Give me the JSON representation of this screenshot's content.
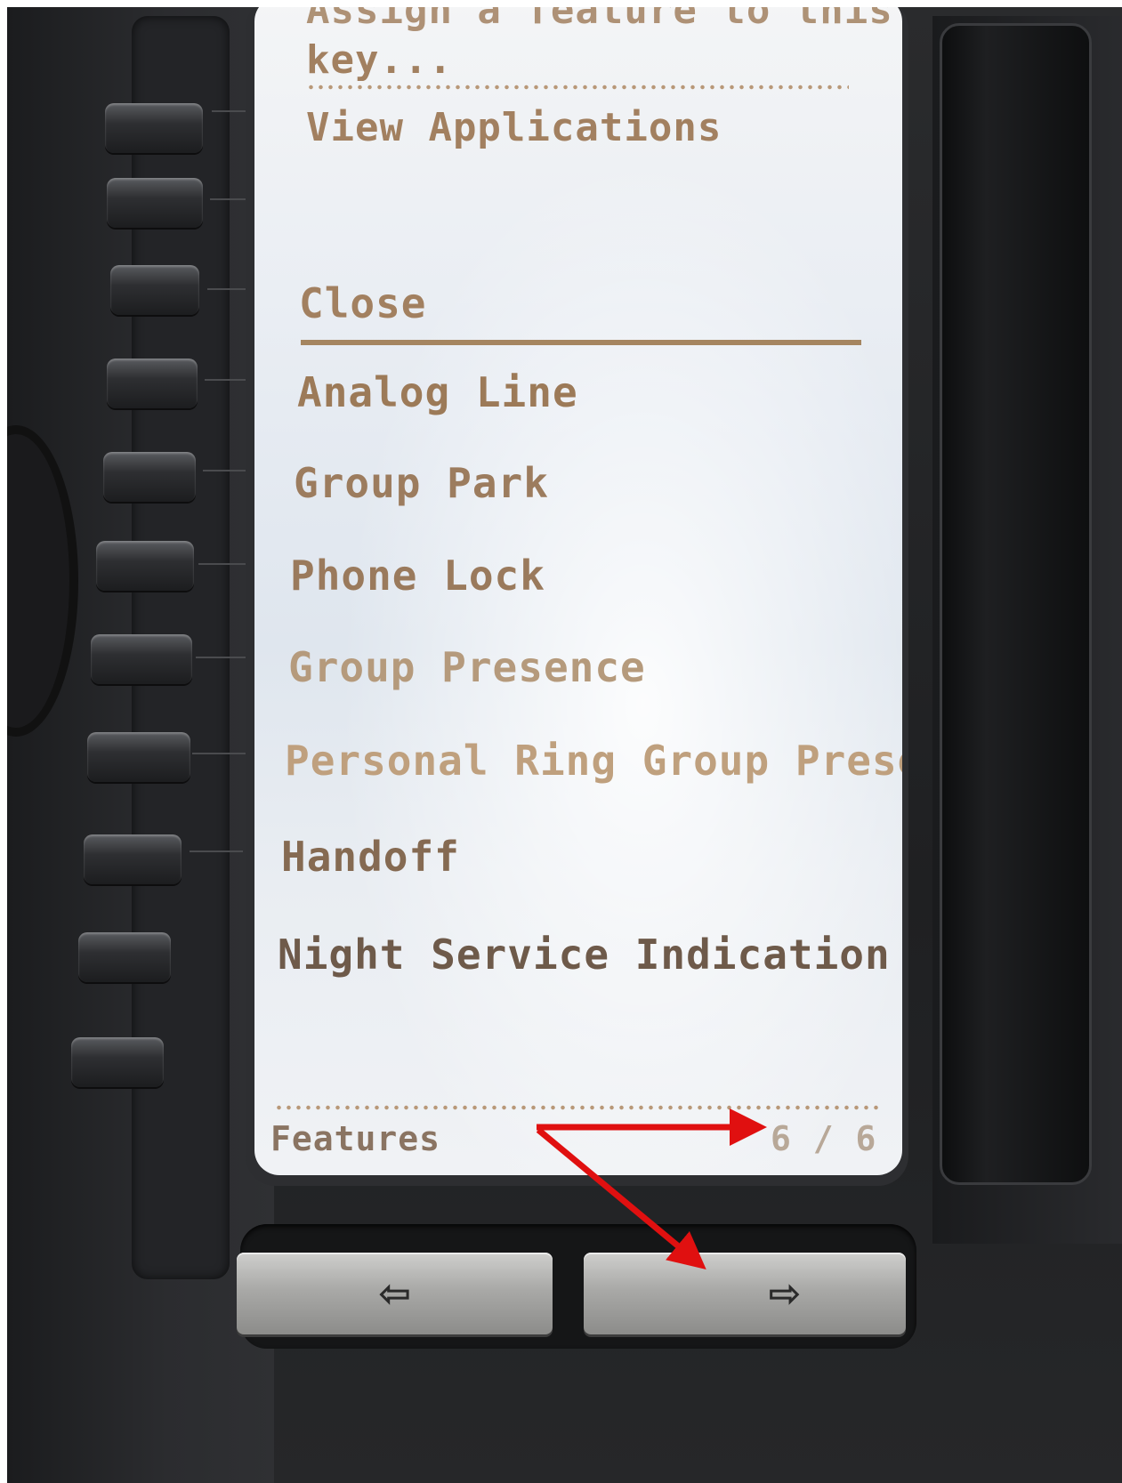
{
  "screen": {
    "header_partial": "Assign a feature to this",
    "header_line2": "key...",
    "view_applications": "View Applications",
    "close": "Close",
    "menu_items": [
      "Analog Line",
      "Group Park",
      "Phone Lock",
      "Group Presence",
      "Personal Ring Group Prese",
      "Handoff",
      "Night Service Indication"
    ],
    "footer_title": "Features",
    "page_indicator": "6 / 6"
  },
  "nav_keys": {
    "left_icon": "left-arrow-icon",
    "left_glyph": "⇦",
    "right_icon": "right-arrow-icon",
    "right_glyph": "⇨"
  },
  "colors": {
    "screen_text": "#a28060",
    "annotation": "#e01010"
  }
}
